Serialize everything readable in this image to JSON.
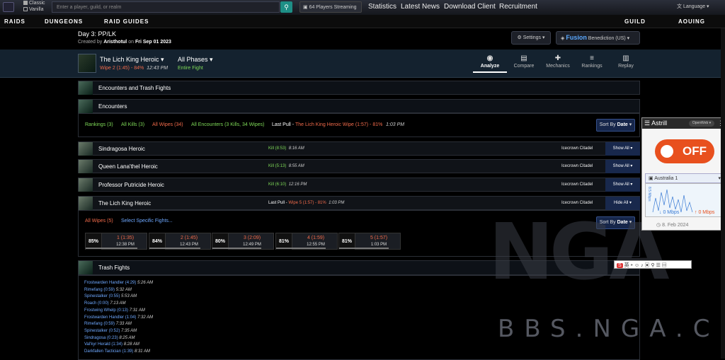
{
  "topbar": {
    "radios": [
      "Classic",
      "Vanilla"
    ],
    "search_placeholder": "Enter a player, guild, or realm",
    "streaming": "64 Players Streaming",
    "links": [
      "Statistics",
      "Latest News",
      "Download Client",
      "Recruitment"
    ],
    "language": "Language"
  },
  "nav": {
    "items": [
      "RAIDS",
      "DUNGEONS",
      "RAID GUIDES"
    ],
    "right": [
      "GUILD",
      "AOUING"
    ]
  },
  "report": {
    "title": "Day 3: PP/LK",
    "created_prefix": "Created by",
    "author": "Aristhotul",
    "created_suffix": "on",
    "date": "Fri Sep 01 2023",
    "settings": "Settings",
    "region": "Fusion",
    "realm": "Benediction (US)"
  },
  "fight_header": {
    "boss": "The Lich King Heroic",
    "wipe": "Wipe 2 (1:45) - 84%",
    "time": "12:43 PM",
    "phases": "All Phases",
    "entire": "Entire Fight"
  },
  "tabs": [
    {
      "label": "Analyze",
      "icon": "eye-icon"
    },
    {
      "label": "Compare",
      "icon": "compare-icon"
    },
    {
      "label": "Mechanics",
      "icon": "puzzle-icon"
    },
    {
      "label": "Rankings",
      "icon": "rankings-icon"
    },
    {
      "label": "Replay",
      "icon": "replay-icon"
    }
  ],
  "sections": {
    "encounters_trash": "Encounters and Trash Fights",
    "encounters": "Encounters",
    "trash": "Trash Fights"
  },
  "stats": {
    "rankings": "Rankings (3)",
    "kills": "All Kills (3)",
    "wipes": "All Wipes (34)",
    "encounters": "All Encounters (3 Kills, 34 Wipes)",
    "last_pull_label": "Last Pull -",
    "last_pull": "The Lich King Heroic Wipe (1:57) - 81%",
    "last_time": "1:03 PM",
    "sort_label": "Sort By",
    "sort_value": "Date"
  },
  "encounters": [
    {
      "name": "Sindragosa Heroic",
      "result": "Kill (8:53)",
      "time": "8:16 AM",
      "zone": "Icecrown Citadel",
      "btn": "Show All"
    },
    {
      "name": "Queen Lana'thel Heroic",
      "result": "Kill (5:13)",
      "time": "8:55 AM",
      "zone": "Icecrown Citadel",
      "btn": "Show All"
    },
    {
      "name": "Professor Putricide Heroic",
      "result": "Kill (6:10)",
      "time": "12:16 PM",
      "zone": "Icecrown Citadel",
      "btn": "Show All"
    },
    {
      "name": "The Lich King Heroic",
      "result_prefix": "Last Pull -",
      "result": "Wipe 5 (1:57) - 81%",
      "time": "1:03 PM",
      "zone": "Icecrown Citadel",
      "btn": "Hide All"
    }
  ],
  "lk_details": {
    "all_wipes": "All Wipes (5)",
    "select": "Select Specific Fights...",
    "fights": [
      {
        "pct": "85%",
        "num": "1 (1:35)",
        "time": "12:38 PM",
        "fill": 0.85
      },
      {
        "pct": "84%",
        "num": "2 (1:45)",
        "time": "12:43 PM",
        "fill": 0.84
      },
      {
        "pct": "80%",
        "num": "3 (2:09)",
        "time": "12:49 PM",
        "fill": 0.8
      },
      {
        "pct": "81%",
        "num": "4 (1:59)",
        "time": "12:55 PM",
        "fill": 0.81
      },
      {
        "pct": "81%",
        "num": "5 (1:57)",
        "time": "1:03 PM",
        "fill": 0.81
      }
    ]
  },
  "trash": [
    {
      "name": "Frostwarden Handler (4:29)",
      "time": "5:26 AM"
    },
    {
      "name": "Rimefang (0:59)",
      "time": "5:32 AM"
    },
    {
      "name": "Spinestalker (0:55)",
      "time": "5:53 AM"
    },
    {
      "name": "Roach (0:00)",
      "time": "7:13 AM"
    },
    {
      "name": "Frostwing Whelp (0:13)",
      "time": "7:31 AM"
    },
    {
      "name": "Frostwarden Handler (1:04)",
      "time": "7:32 AM"
    },
    {
      "name": "Rimefang (0:59)",
      "time": "7:33 AM"
    },
    {
      "name": "Spinestalker (0:52)",
      "time": "7:35 AM"
    },
    {
      "name": "Sindragosa (0:23)",
      "time": "8:25 AM"
    },
    {
      "name": "Val'kyr Herald (1:34)",
      "time": "8:28 AM"
    },
    {
      "name": "Darkfallen Tactician (1:39)",
      "time": "8:31 AM"
    }
  ],
  "astrill": {
    "title": "Astrill",
    "mode": "OpenWeb",
    "state": "OFF",
    "server": "Australia 1",
    "down": "0 Mbps",
    "up": "0 Mbps",
    "date": "8. Feb 2024",
    "axis": "8.5 Mbps"
  },
  "ime": {
    "lang": "英"
  },
  "watermark": {
    "logo": "NGA",
    "site": "BBS.NGA.CN"
  },
  "colors": {
    "kill": "#7ed957",
    "wipe": "#f06a4a",
    "link": "#6ea8ff",
    "accent": "#1e8f86",
    "astrill_off": "#e8501e"
  }
}
